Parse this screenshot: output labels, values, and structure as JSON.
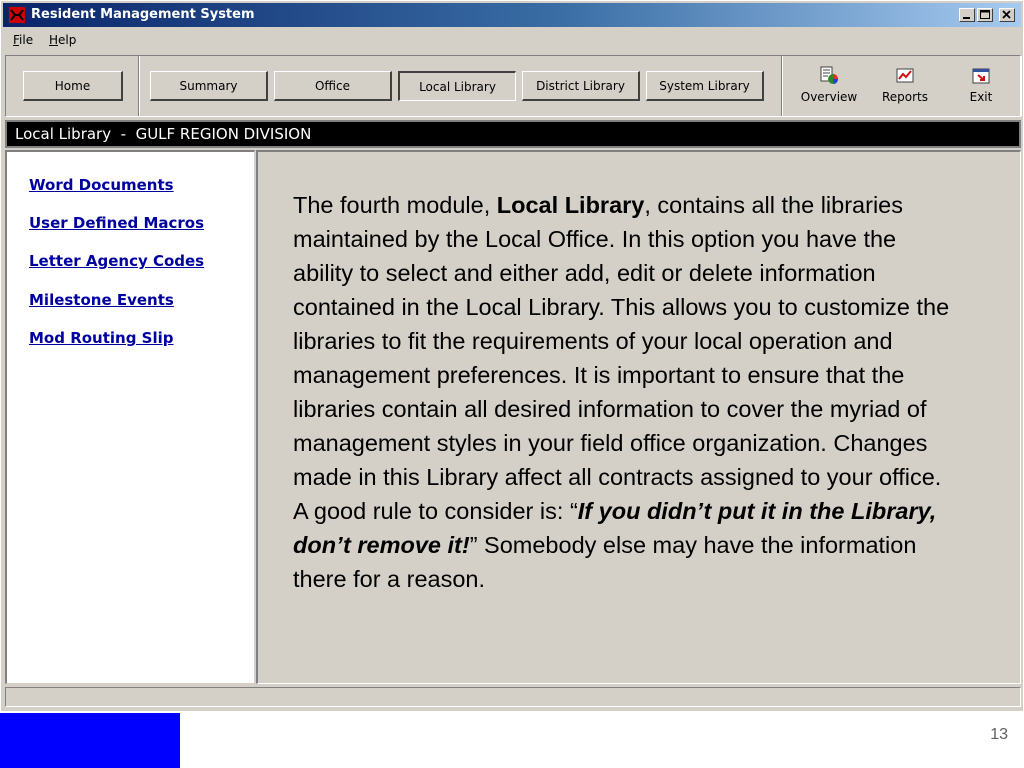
{
  "window": {
    "title": "Resident Management System"
  },
  "menu": {
    "file_label": "File",
    "file_rest": "ile",
    "file_key": "F",
    "help_key": "H",
    "help_rest": "elp"
  },
  "toolbar": {
    "home": "Home",
    "tabs": [
      "Summary",
      "Office",
      "Local Library",
      "District Library",
      "System Library"
    ],
    "active_tab": "Local Library",
    "overview": "Overview",
    "reports": "Reports",
    "exit": "Exit"
  },
  "section_header": "Local Library  -  GULF REGION DIVISION",
  "nav_links": [
    "Word Documents",
    "User Defined Macros",
    "Letter Agency Codes",
    "Milestone Events",
    "Mod Routing Slip"
  ],
  "content": {
    "p1_before": "The fourth module, ",
    "p1_bold": "Local Library",
    "p1_after": ", contains all the libraries maintained by the Local Office.  In this option you have the ability to select and either add, edit or delete information contained in the Local Library.  This allows you to customize the libraries to fit the requirements of your local operation and management preferences. It is important to ensure that the libraries contain all desired information to cover the myriad of management styles in your field office organization. Changes made in this Library affect all contracts assigned to your office. A good rule to consider is: “",
    "p1_bold_italic": "If you didn’t put it in the Library, don’t remove it!",
    "p1_end": "” Somebody else may have the information there for a reason."
  },
  "colors": {
    "accent_blue": "#0000ff",
    "link": "#0000a0",
    "title_bar": "#0a246a"
  },
  "page_number": "13"
}
